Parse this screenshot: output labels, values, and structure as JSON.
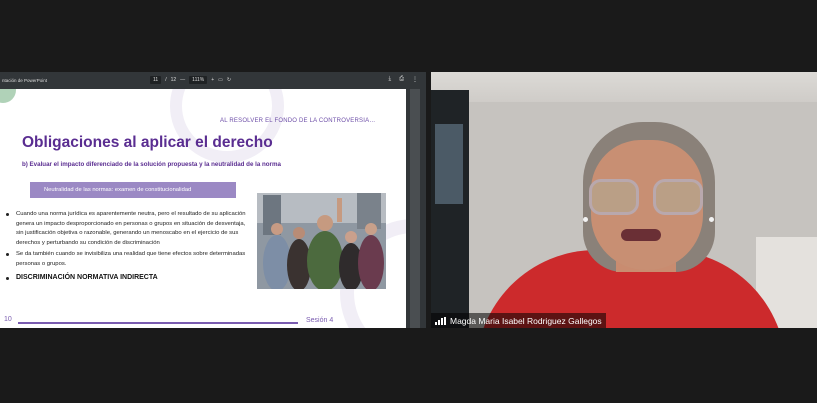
{
  "pdf_viewer": {
    "title": "ntación de PowerPoint",
    "page_current": "11",
    "page_sep": "/",
    "page_total": "12",
    "zoom_out": "—",
    "zoom": "111%",
    "zoom_in": "+",
    "icons": [
      "fit-page-icon",
      "rotate-icon",
      "download-icon",
      "print-icon",
      "more-icon"
    ]
  },
  "slide": {
    "kicker": "AL RESOLVER EL FONDO DE LA CONTROVERSIA…",
    "title": "Obligaciones al aplicar el derecho",
    "subtitle": "b) Evaluar el impacto diferenciado de la solución propuesta y la neutralidad de la norma",
    "tag": "Neutralidad de las normas: examen de constitucionalidad",
    "bullets": [
      "Cuando una norma jurídica es aparentemente neutra, pero el resultado de su aplicación genera un impacto desproporcionado en personas o grupos en situación de desventaja, sin justificación objetiva o razonable, generando un menoscabo en el ejercicio de sus derechos y perturbando su condición de discriminación",
      "Se da también cuando se invisibiliza una realidad que tiene efectos sobre determinadas personas o grupos."
    ],
    "bold_bullet": "DISCRIMINACIÓN NORMATIVA INDIRECTA",
    "page_number": "10",
    "session": "Sesión 4"
  },
  "video": {
    "participant_name": "Magda Maria Isabel Rodriguez Gallegos"
  },
  "colors": {
    "accent_purple": "#5a2d91",
    "tag_purple": "#9b89c4",
    "shirt_red": "#cc2a2c"
  }
}
